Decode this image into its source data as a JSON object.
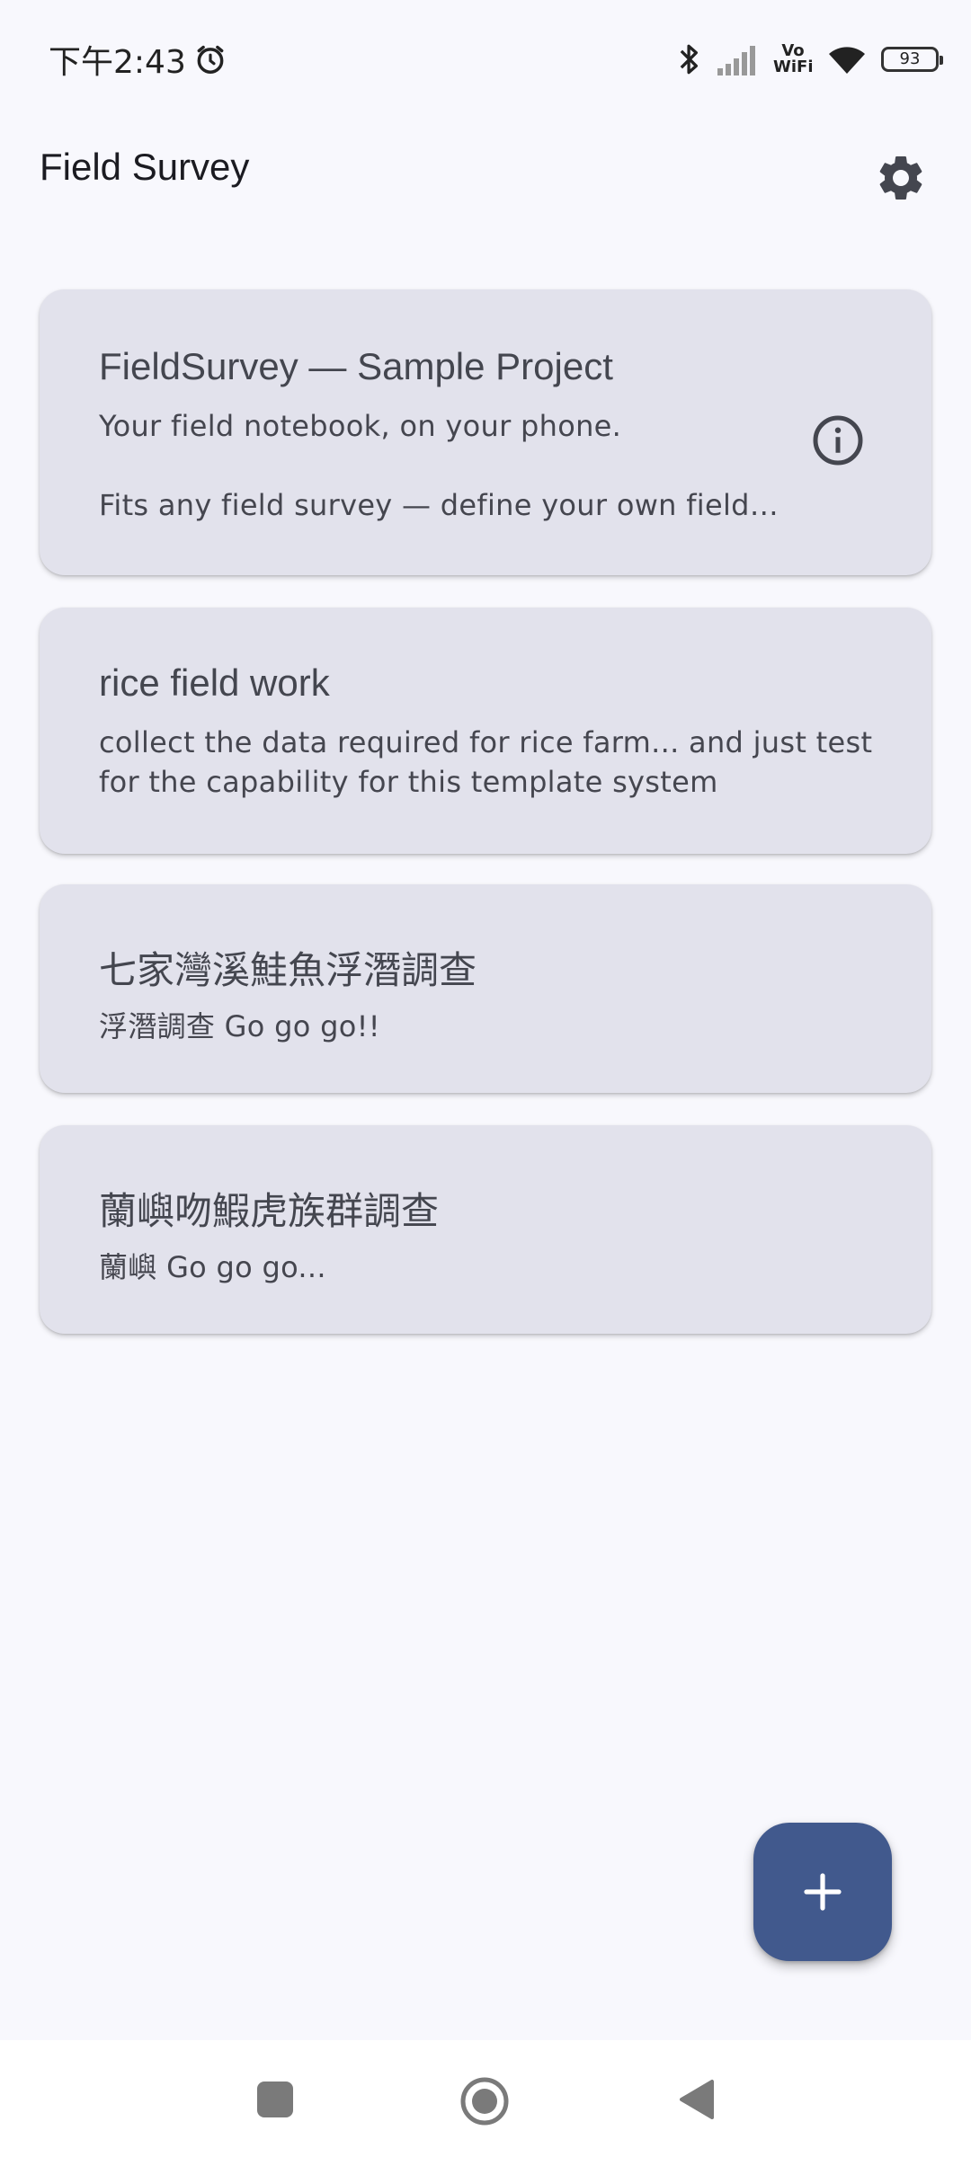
{
  "status_bar": {
    "time": "下午2:43",
    "vo": "Vo",
    "wifi_label": "WiFi",
    "battery": "93",
    "icons": [
      "alarm-icon",
      "bluetooth-icon",
      "signal-icon",
      "wifi-icon",
      "battery-icon"
    ]
  },
  "app_bar": {
    "title": "Field Survey",
    "settings_icon": "gear-icon"
  },
  "projects": [
    {
      "title": "FieldSurvey — Sample Project",
      "desc_line1": "Your field notebook, on your phone.",
      "desc_line2": "Fits any field survey — define your own field…",
      "action_icon": "info-icon"
    },
    {
      "title": "rice field work",
      "desc": "collect the data required for rice farm... and just test for the capability for this template system"
    },
    {
      "title": "七家灣溪鮭魚浮潛調查",
      "desc": "浮潛調查 Go go go!!"
    },
    {
      "title": "蘭嶼吻鰕虎族群調查",
      "desc": "蘭嶼 Go go go..."
    }
  ],
  "fab": {
    "icon": "plus-icon",
    "color": "#41598d"
  },
  "nav_bar": {
    "icons": [
      "recents-icon",
      "home-icon",
      "back-icon"
    ]
  },
  "colors": {
    "background": "#f8f8fd",
    "card": "#e2e2ec",
    "accent": "#41598d"
  }
}
